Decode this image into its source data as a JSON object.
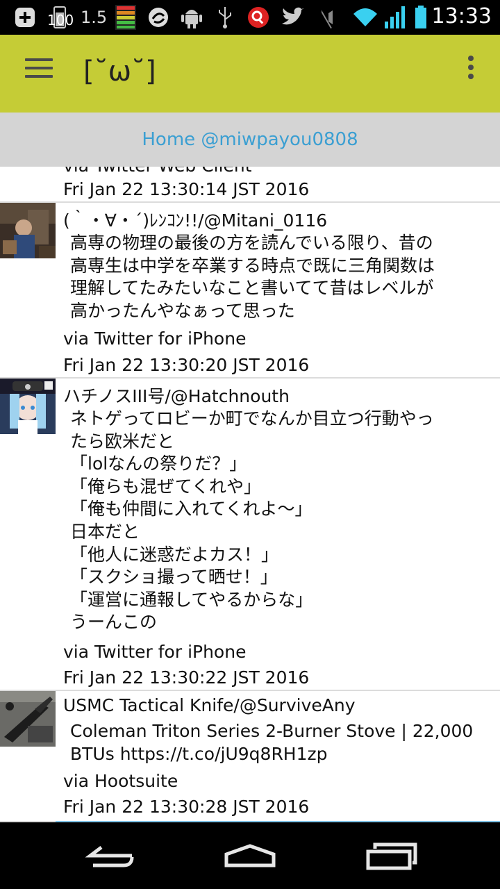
{
  "status_bar": {
    "battery_small": "100",
    "speed": "1.5",
    "time": "13:33",
    "icons": [
      "add-icon",
      "battery-mini-icon",
      "level-meter-icon",
      "sync-icon",
      "android-icon",
      "usb-icon",
      "search-app-icon",
      "twitter-icon",
      "muted-icon",
      "wifi-icon",
      "signal-icon",
      "battery-icon"
    ]
  },
  "app_bar": {
    "title": "[˘ω˘]",
    "icons": [
      "menu-icon",
      "overflow-icon"
    ],
    "color": "#c5cc36"
  },
  "tab_header": {
    "label": "Home @miwpayou0808",
    "color": "#3b9fd2"
  },
  "timeline": {
    "partial_item": {
      "via": "via Twitter Web Client",
      "date": "Fri Jan 22 13:30:14 JST 2016"
    },
    "items": [
      {
        "user": "(｀・∀・´)ﾚﾝｺﾝ!!/@Mitani_0116",
        "text": "高専の物理の最後の方を読んでいる限り、昔の\n高専生は中学を卒業する時点で既に三角関数は\n理解してたみたいなこと書いてて昔はレベルが\n高かったんやなぁって思った",
        "via": "via Twitter for iPhone",
        "date": "Fri Jan 22 13:30:20 JST 2016"
      },
      {
        "user": "ハチノスIII号/@Hatchnouth",
        "text": "ネトゲってロビーか町でなんか目立つ行動やっ\nたら欧米だと\n「lolなんの祭りだ？」\n「俺らも混ぜてくれや」\n「俺も仲間に入れてくれよ～」\n日本だと\n「他人に迷惑だよカス！」\n「スクショ撮って晒せ！」\n「運営に通報してやるからな」\nうーんこの",
        "via": "via Twitter for iPhone",
        "date": "Fri Jan 22 13:30:22 JST 2016"
      },
      {
        "user": "USMC Tactical Knife/@SurviveAny",
        "text": "Coleman Triton Series 2-Burner Stove | 22,000\nBTUs https://t.co/jU9q8RH1zp",
        "via": "via Hootsuite",
        "date": "Fri Jan 22 13:30:28 JST 2016"
      }
    ]
  },
  "nav_bar": {
    "icons": [
      "back-icon",
      "home-icon",
      "recent-apps-icon"
    ]
  }
}
